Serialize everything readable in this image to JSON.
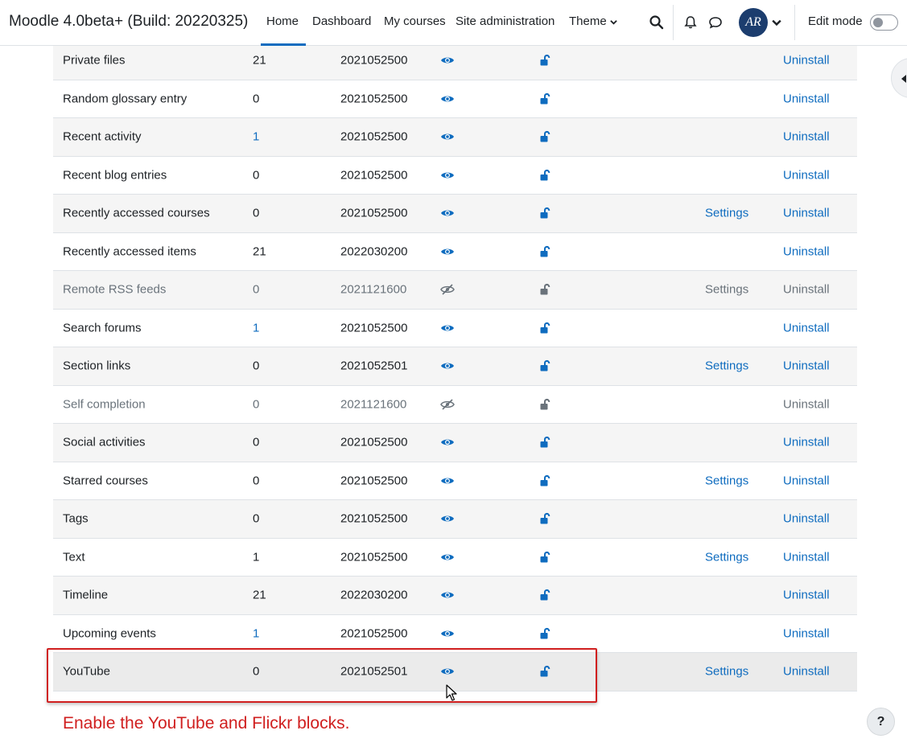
{
  "navbar": {
    "brand": "Moodle 4.0beta+ (Build: 20220325)",
    "items": [
      {
        "label": "Home",
        "active": true
      },
      {
        "label": "Dashboard"
      },
      {
        "label": "My courses"
      },
      {
        "label": "Site administration"
      },
      {
        "label": "Theme"
      }
    ],
    "avatar_initials": "AR",
    "edit_mode_label": "Edit mode",
    "edit_mode_on": false
  },
  "table": {
    "rows": [
      {
        "name": "Private files",
        "count": "21",
        "count_link": false,
        "version": "2021052500",
        "visible": true,
        "settings": "",
        "uninstall": "Uninstall"
      },
      {
        "name": "Random glossary entry",
        "count": "0",
        "count_link": false,
        "version": "2021052500",
        "visible": true,
        "settings": "",
        "uninstall": "Uninstall"
      },
      {
        "name": "Recent activity",
        "count": "1",
        "count_link": true,
        "version": "2021052500",
        "visible": true,
        "settings": "",
        "uninstall": "Uninstall"
      },
      {
        "name": "Recent blog entries",
        "count": "0",
        "count_link": false,
        "version": "2021052500",
        "visible": true,
        "settings": "",
        "uninstall": "Uninstall"
      },
      {
        "name": "Recently accessed courses",
        "count": "0",
        "count_link": false,
        "version": "2021052500",
        "visible": true,
        "settings": "Settings",
        "uninstall": "Uninstall"
      },
      {
        "name": "Recently accessed items",
        "count": "21",
        "count_link": false,
        "version": "2022030200",
        "visible": true,
        "settings": "",
        "uninstall": "Uninstall"
      },
      {
        "name": "Remote RSS feeds",
        "count": "0",
        "count_link": false,
        "version": "2021121600",
        "visible": false,
        "settings": "Settings",
        "uninstall": "Uninstall"
      },
      {
        "name": "Search forums",
        "count": "1",
        "count_link": true,
        "version": "2021052500",
        "visible": true,
        "settings": "",
        "uninstall": "Uninstall"
      },
      {
        "name": "Section links",
        "count": "0",
        "count_link": false,
        "version": "2021052501",
        "visible": true,
        "settings": "Settings",
        "uninstall": "Uninstall"
      },
      {
        "name": "Self completion",
        "count": "0",
        "count_link": false,
        "version": "2021121600",
        "visible": false,
        "settings": "",
        "uninstall": "Uninstall"
      },
      {
        "name": "Social activities",
        "count": "0",
        "count_link": false,
        "version": "2021052500",
        "visible": true,
        "settings": "",
        "uninstall": "Uninstall"
      },
      {
        "name": "Starred courses",
        "count": "0",
        "count_link": false,
        "version": "2021052500",
        "visible": true,
        "settings": "Settings",
        "uninstall": "Uninstall"
      },
      {
        "name": "Tags",
        "count": "0",
        "count_link": false,
        "version": "2021052500",
        "visible": true,
        "settings": "",
        "uninstall": "Uninstall"
      },
      {
        "name": "Text",
        "count": "1",
        "count_link": false,
        "version": "2021052500",
        "visible": true,
        "settings": "Settings",
        "uninstall": "Uninstall"
      },
      {
        "name": "Timeline",
        "count": "21",
        "count_link": false,
        "version": "2022030200",
        "visible": true,
        "settings": "",
        "uninstall": "Uninstall"
      },
      {
        "name": "Upcoming events",
        "count": "1",
        "count_link": true,
        "version": "2021052500",
        "visible": true,
        "settings": "",
        "uninstall": "Uninstall"
      },
      {
        "name": "YouTube",
        "count": "0",
        "count_link": false,
        "version": "2021052501",
        "visible": true,
        "settings": "Settings",
        "uninstall": "Uninstall"
      }
    ]
  },
  "annotation": {
    "caption": "Enable the YouTube and Flickr blocks."
  },
  "help_label": "?",
  "colors": {
    "link": "#0f6cbf",
    "muted": "#6a737b",
    "annotation_red": "#d01f1f",
    "row_stripe": "#f5f5f5"
  },
  "icons": {
    "visible": "eye-icon",
    "hidden": "eye-slash-icon",
    "lock": "unlock-icon"
  }
}
